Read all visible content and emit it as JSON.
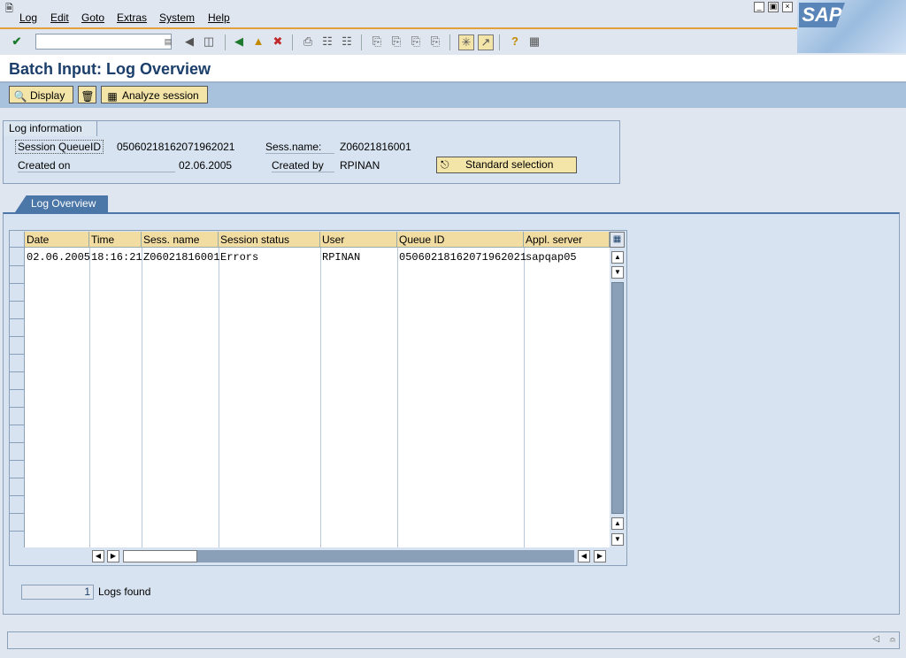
{
  "menu": {
    "items": [
      "Log",
      "Edit",
      "Goto",
      "Extras",
      "System",
      "Help"
    ]
  },
  "brand": {
    "logo_text": "SAP"
  },
  "toolbar": {
    "icons": [
      "enter-icon",
      "back-icon",
      "exit-icon",
      "cancel-icon",
      "print-icon",
      "find-icon",
      "find-next-icon",
      "first-page-icon",
      "previous-page-icon",
      "next-page-icon",
      "last-page-icon",
      "create-session-icon",
      "shortcut-icon",
      "help-icon",
      "layout-icon"
    ]
  },
  "page": {
    "title": "Batch Input: Log Overview"
  },
  "app_toolbar": {
    "display_label": "Display",
    "analyze_label": "Analyze session"
  },
  "log_info": {
    "group_title": "Log information",
    "queue_id_label": "Session QueueID",
    "queue_id_value": "05060218162071962021",
    "sess_name_label": "Sess.name:",
    "sess_name_value": "Z06021816001",
    "created_on_label": "Created on",
    "created_on_value": "02.06.2005",
    "created_by_label": "Created by",
    "created_by_value": "RPINAN",
    "standard_selection_label": "Standard selection"
  },
  "log_overview": {
    "tab_label": "Log Overview",
    "columns": [
      "Date",
      "Time",
      "Sess. name",
      "Session status",
      "User",
      "Queue ID",
      "Appl. server"
    ],
    "rows": [
      [
        "02.06.2005",
        "18:16:21",
        "Z06021816001",
        "Errors",
        "RPINAN",
        "05060218162071962021",
        "sapqap05"
      ]
    ]
  },
  "footer": {
    "logs_count": "1",
    "logs_label": "Logs found"
  },
  "colors": {
    "header_bg": "#f1dca2",
    "tab_active": "#4a76a8",
    "title": "#1b3e6a"
  }
}
